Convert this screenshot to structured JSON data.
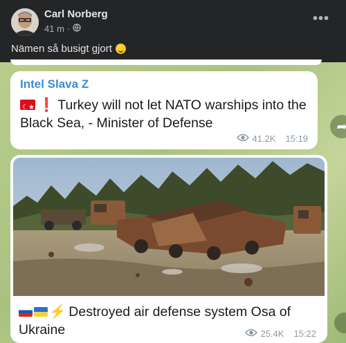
{
  "post": {
    "author": "Carl Norberg",
    "time": "41 m",
    "separator": "·",
    "caption": "Nämen så busigt gjort",
    "more_icon": "more-dots-icon",
    "privacy_icon": "globe-icon"
  },
  "messages": [
    {
      "channel": "Intel Slava Z",
      "text": "Turkey will not let NATO warships into the Black Sea, - Minister of Defense",
      "views": "41.2K",
      "time": "15:19"
    },
    {
      "text": "Destroyed air defense system Osa of Ukraine",
      "views": "25.4K",
      "time": "15:22"
    }
  ],
  "colors": {
    "background_dark": "#242526",
    "chat_background": "#b8cf8c",
    "channel_name": "#3a8bd1",
    "bubble": "#ffffff"
  }
}
